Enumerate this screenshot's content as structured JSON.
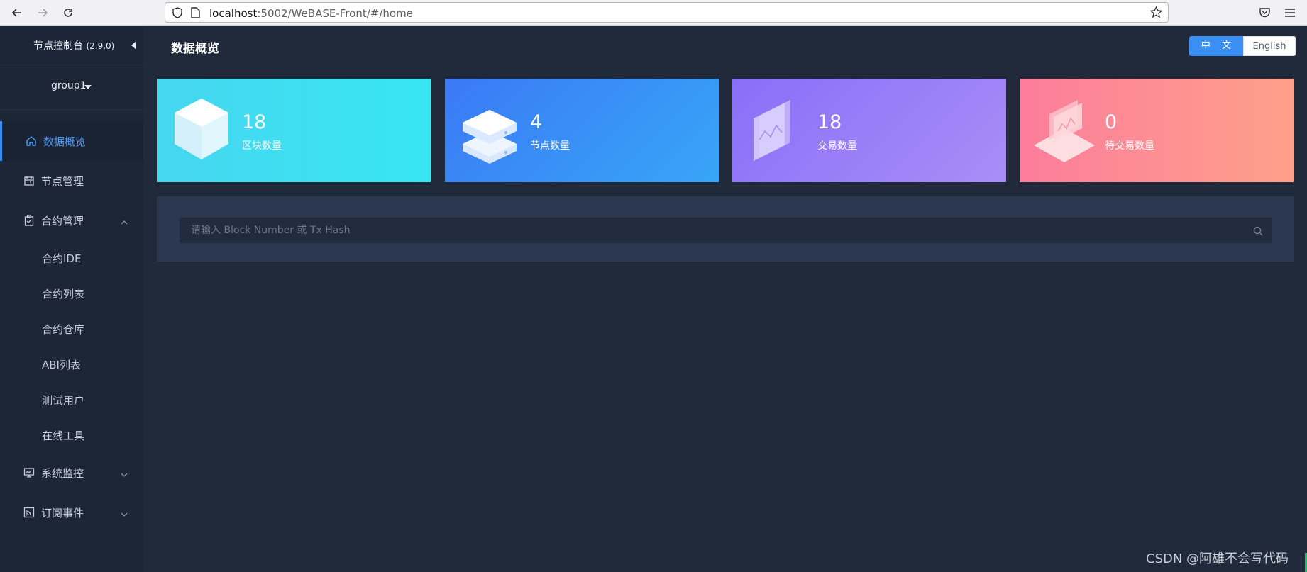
{
  "browser": {
    "url_host": "localhost",
    "url_rest": ":5002/WeBASE-Front/#/home"
  },
  "sidebar": {
    "title": "节点控制台",
    "version": "(2.9.0)",
    "group": "group1",
    "menu": [
      {
        "label": "数据概览",
        "icon": "home-icon",
        "active": true
      },
      {
        "label": "节点管理",
        "icon": "calendar-icon"
      },
      {
        "label": "合约管理",
        "icon": "clipboard-icon",
        "expanded": true
      }
    ],
    "sub_items": [
      "合约IDE",
      "合约列表",
      "合约仓库",
      "ABI列表",
      "测试用户",
      "在线工具"
    ],
    "menu_bottom": [
      {
        "label": "系统监控",
        "icon": "monitor-icon"
      },
      {
        "label": "订阅事件",
        "icon": "rss-icon"
      }
    ]
  },
  "header": {
    "title": "数据概览",
    "lang_zh": "中 文",
    "lang_en": "English"
  },
  "cards": [
    {
      "value": "18",
      "label": "区块数量",
      "icon": "cube-icon",
      "colors": [
        "#46d6f0",
        "#38e3f2"
      ]
    },
    {
      "value": "4",
      "label": "节点数量",
      "icon": "server-icon",
      "colors": [
        "#3d7cf6",
        "#36a2f6"
      ]
    },
    {
      "value": "18",
      "label": "交易数量",
      "icon": "chart-panel-icon",
      "colors": [
        "#8a72f8",
        "#a88af7"
      ]
    },
    {
      "value": "0",
      "label": "待交易数量",
      "icon": "laptop-icon",
      "colors": [
        "#fb7f99",
        "#fd9e8a"
      ]
    }
  ],
  "search": {
    "placeholder": "请输入 Block Number 或 Tx Hash"
  },
  "watermark": "CSDN @阿雄不会写代码"
}
